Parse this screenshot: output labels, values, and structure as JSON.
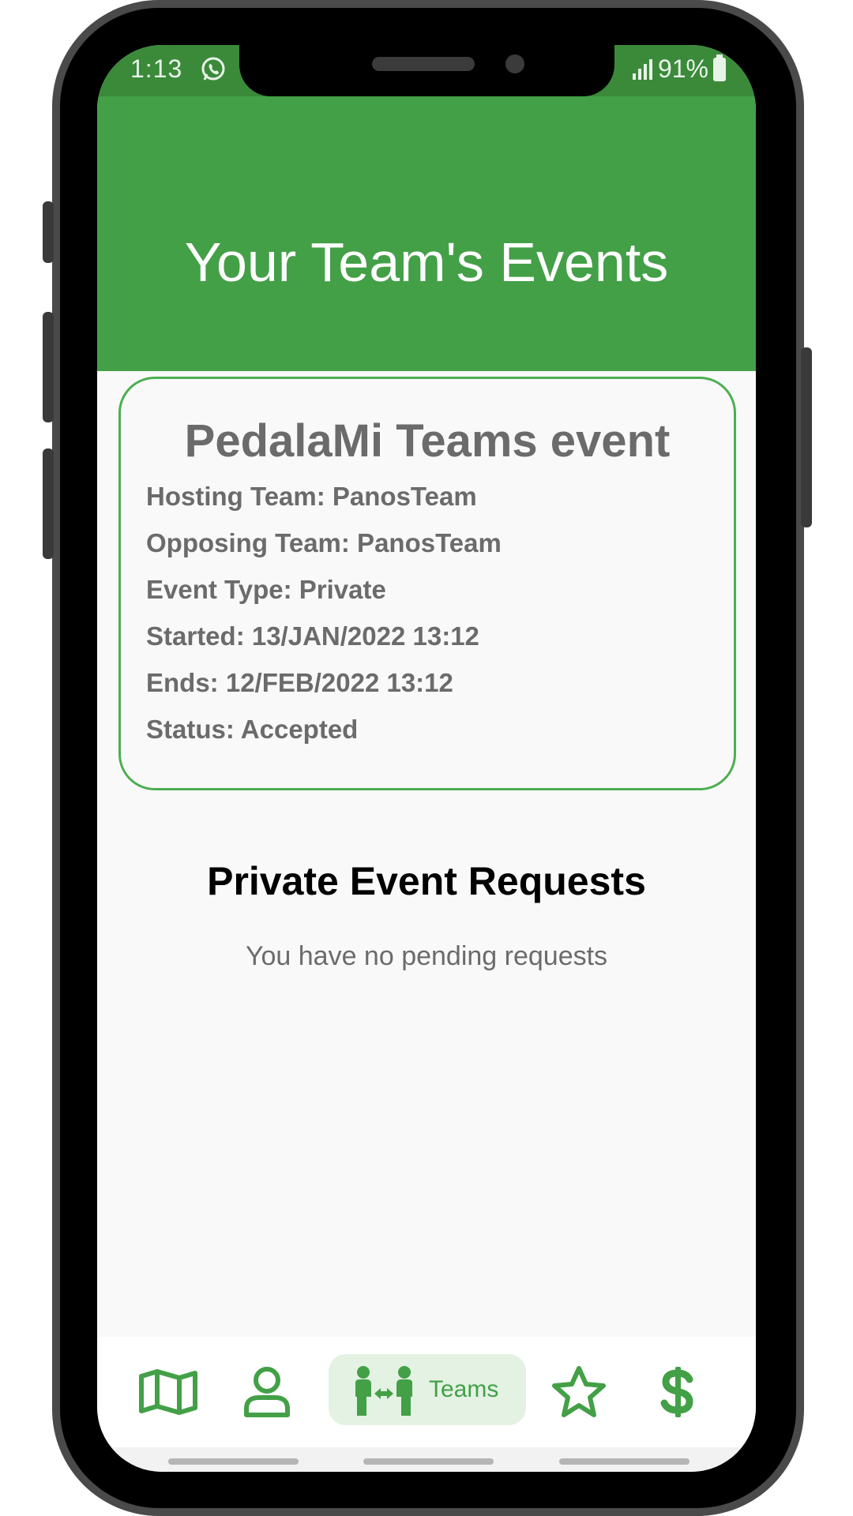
{
  "status_bar": {
    "time": "1:13",
    "battery": "91%",
    "whatsapp_icon": "whatsapp-icon",
    "signal_icon": "signal-icon",
    "battery_icon": "battery-icon"
  },
  "header": {
    "title": "Your Team's Events",
    "color": "#43a047"
  },
  "event_card": {
    "title": "PedalaMi Teams event",
    "lines": [
      "Hosting Team: PanosTeam",
      "Opposing Team: PanosTeam",
      "Event Type: Private",
      "Started: 13/JAN/2022 13:12",
      "Ends: 12/FEB/2022 13:12",
      "Status: Accepted"
    ],
    "border_color": "#4caf50"
  },
  "requests": {
    "title": "Private Event Requests",
    "empty_text": "You have no pending requests"
  },
  "bottom_nav": {
    "items": [
      {
        "icon": "map-icon"
      },
      {
        "icon": "profile-icon"
      },
      {
        "icon": "teams-icon",
        "label": "Teams",
        "active": true
      },
      {
        "icon": "star-icon"
      },
      {
        "icon": "dollar-icon"
      }
    ],
    "accent": "#43a047",
    "active_bg": "#e3f2e3"
  }
}
